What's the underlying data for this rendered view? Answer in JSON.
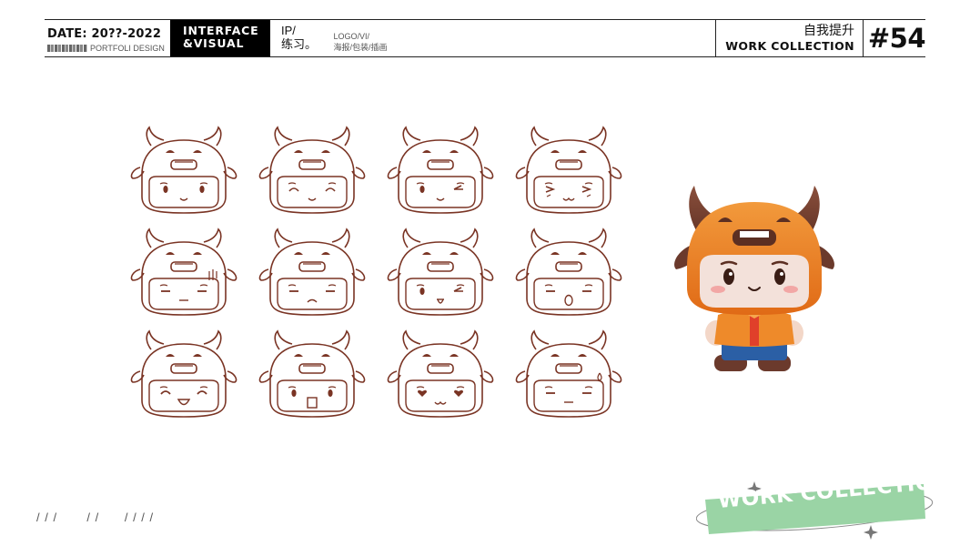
{
  "header": {
    "date_label": "DATE: 20??-2022",
    "sub_label": "PORTFOLI DESIGN",
    "category_line1": "INTERFACE",
    "category_line2": "&VISUAL",
    "project_title_line1": "IP/",
    "project_title_line2": "练习。",
    "project_sub_line1": "LOGO/VI/",
    "project_sub_line2": "海报/包装/插画",
    "work_cn": "自我提升",
    "work_en": "WORK COLLECTION",
    "page_number": "#54"
  },
  "expressions": {
    "count": 12,
    "line_color": "#7a3424"
  },
  "mascot": {
    "hat_color": "#e9731e",
    "horn_color": "#6b3a2c",
    "shirt_color": "#ee8a2a",
    "pants_color": "#2b5fa5",
    "shoe_color": "#6b3a2c"
  },
  "footer": {
    "slashes": "/ / /       / /      / / / /",
    "badge_text": "WORK COLLECTION",
    "badge_color": "#9ad4a5"
  }
}
